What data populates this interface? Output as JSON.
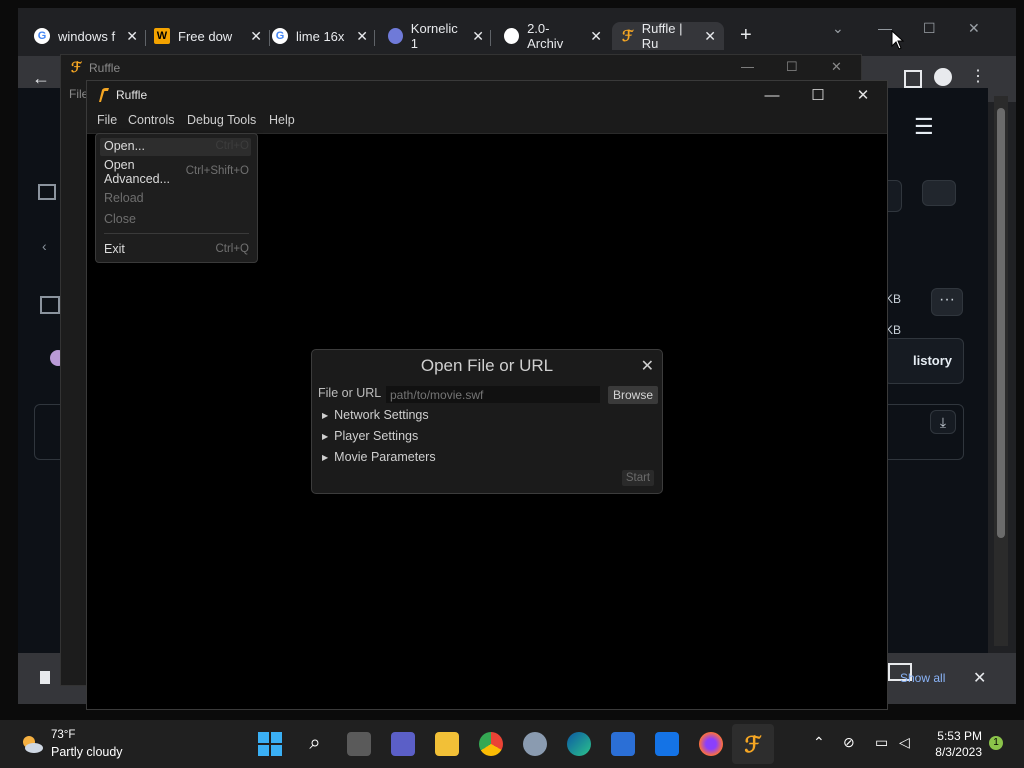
{
  "browser": {
    "tabs": [
      {
        "title": "windows f",
        "icon": "google-icon"
      },
      {
        "title": "Free dow",
        "icon": "w-icon"
      },
      {
        "title": "lime 16x",
        "icon": "google-icon"
      },
      {
        "title": "Kornelic 1",
        "icon": "kornelic-icon"
      },
      {
        "title": "2.0-Archiv",
        "icon": "github-icon"
      },
      {
        "title": "Ruffle | Ru",
        "icon": "ruffle-icon"
      }
    ],
    "new_tab": "+",
    "kb_labels": [
      "KB",
      "KB",
      "KB"
    ],
    "history_label": "listory",
    "show_all": "Show all"
  },
  "ruffle_bg": {
    "title": "Ruffle"
  },
  "ruffle": {
    "title": "Ruffle",
    "menu": [
      "File",
      "Controls",
      "Debug Tools",
      "Help"
    ],
    "file_menu": {
      "open": "Open...",
      "open_shortcut": "Ctrl+O",
      "open_adv_1": "Open",
      "open_adv_2": "Advanced...",
      "open_adv_shortcut": "Ctrl+Shift+O",
      "reload": "Reload",
      "close": "Close",
      "exit": "Exit",
      "exit_shortcut": "Ctrl+Q"
    },
    "dialog": {
      "title": "Open File or URL",
      "file_label": "File or URL",
      "file_placeholder": "path/to/movie.swf",
      "browse": "Browse",
      "sections": [
        "Network Settings",
        "Player Settings",
        "Movie Parameters"
      ],
      "start": "Start"
    }
  },
  "taskbar": {
    "temp": "73°F",
    "weather": "Partly cloudy",
    "time": "5:53 PM",
    "date": "8/3/2023",
    "notification_count": "1"
  }
}
